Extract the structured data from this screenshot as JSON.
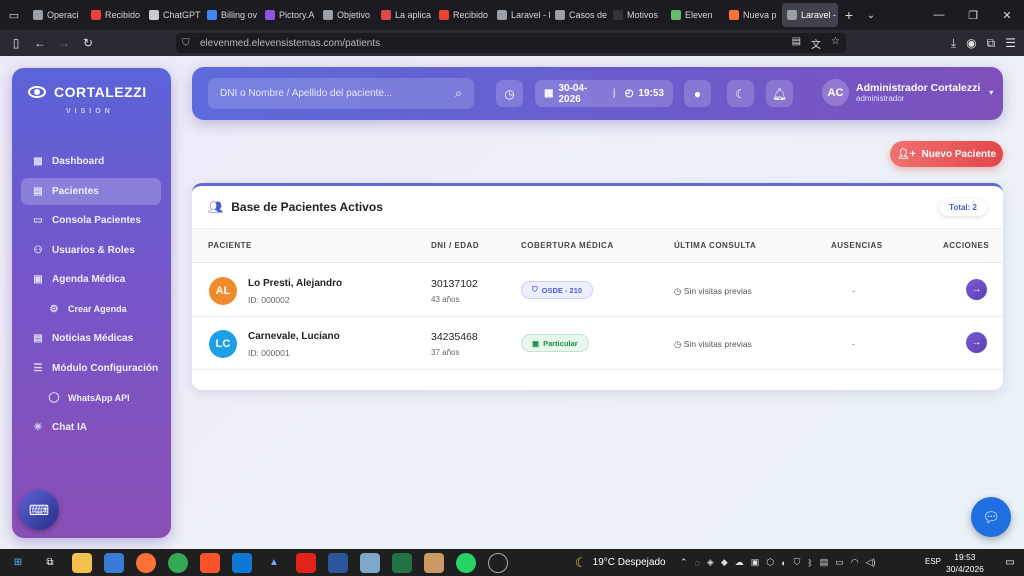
{
  "browser": {
    "tabs": [
      {
        "label": "Operaci",
        "color": "#9aa0a6"
      },
      {
        "label": "Recibido",
        "color": "#ea4335"
      },
      {
        "label": "ChatGPT",
        "color": "#cccccc"
      },
      {
        "label": "Billing ov",
        "color": "#4285f4"
      },
      {
        "label": "Pictory.A",
        "color": "#8a56e2"
      },
      {
        "label": "Objetivo",
        "color": "#9aa0a6"
      },
      {
        "label": "La aplica",
        "color": "#e2474b"
      },
      {
        "label": "Recibido",
        "color": "#ea4335"
      },
      {
        "label": "Laravel - No",
        "color": "#9aa0a6"
      },
      {
        "label": "Casos de Éxi",
        "color": "#9aa0a6"
      },
      {
        "label": "Motivos",
        "color": "#333333"
      },
      {
        "label": "Eleven",
        "color": "#66bb6a"
      },
      {
        "label": "Nueva p",
        "color": "#ff7139"
      },
      {
        "label": "Laravel - E",
        "color": "#9aa0a6",
        "active": true
      }
    ],
    "url": "elevenmed.elevensistemas.com/patients"
  },
  "sidebar": {
    "brand": "CORTALEZZI",
    "brand_sub": "VISION",
    "items": [
      {
        "label": "Dashboard",
        "icon": "grid-icon"
      },
      {
        "label": "Pacientes",
        "icon": "id-card-icon",
        "active": true
      },
      {
        "label": "Consola Pacientes",
        "icon": "monitor-icon"
      },
      {
        "label": "Usuarios & Roles",
        "icon": "users-icon"
      },
      {
        "label": "Agenda Médica",
        "icon": "calendar-icon"
      },
      {
        "label": "Crear Agenda",
        "icon": "gear-icon",
        "sub": true
      },
      {
        "label": "Noticias Médicas",
        "icon": "newspaper-icon"
      },
      {
        "label": "Módulo Configuración",
        "icon": "sliders-icon"
      },
      {
        "label": "WhatsApp API",
        "icon": "whatsapp-icon",
        "sub": true
      },
      {
        "label": "Chat IA",
        "icon": "sparkle-icon"
      }
    ]
  },
  "header": {
    "search_placeholder": "DNI o Nombre / Apellido del paciente...",
    "date": "30-04-2026",
    "time": "19:53",
    "user_initials": "AC",
    "user_name": "Administrador Cortalezzi",
    "user_role": "administrador"
  },
  "actions": {
    "new_patient": "Nuevo Paciente"
  },
  "patients_card": {
    "title": "Base de Pacientes Activos",
    "total": "Total: 2",
    "columns": [
      "PACIENTE",
      "DNI / EDAD",
      "COBERTURA MÉDICA",
      "ÚLTIMA CONSULTA",
      "AUSENCIAS",
      "ACCIONES"
    ],
    "rows": [
      {
        "initials": "AL",
        "avatar_color": "#f08a2c",
        "name": "Lo Presti, Alejandro",
        "id": "ID: 000002",
        "dni": "30137102",
        "age": "43 años",
        "coverage": "OSDE - 210",
        "coverage_style": "osde",
        "last_visit": "Sin visitas previas",
        "absences": "-"
      },
      {
        "initials": "LC",
        "avatar_color": "#1ea0e8",
        "name": "Carnevale, Luciano",
        "id": "ID: 000001",
        "dni": "34235468",
        "age": "37 años",
        "coverage": "Particular",
        "coverage_style": "particular",
        "last_visit": "Sin visitas previas",
        "absences": "-"
      }
    ]
  },
  "taskbar": {
    "weather": "19°C  Despejado",
    "lang": "ESP",
    "time": "19:53",
    "date": "30/4/2026"
  }
}
